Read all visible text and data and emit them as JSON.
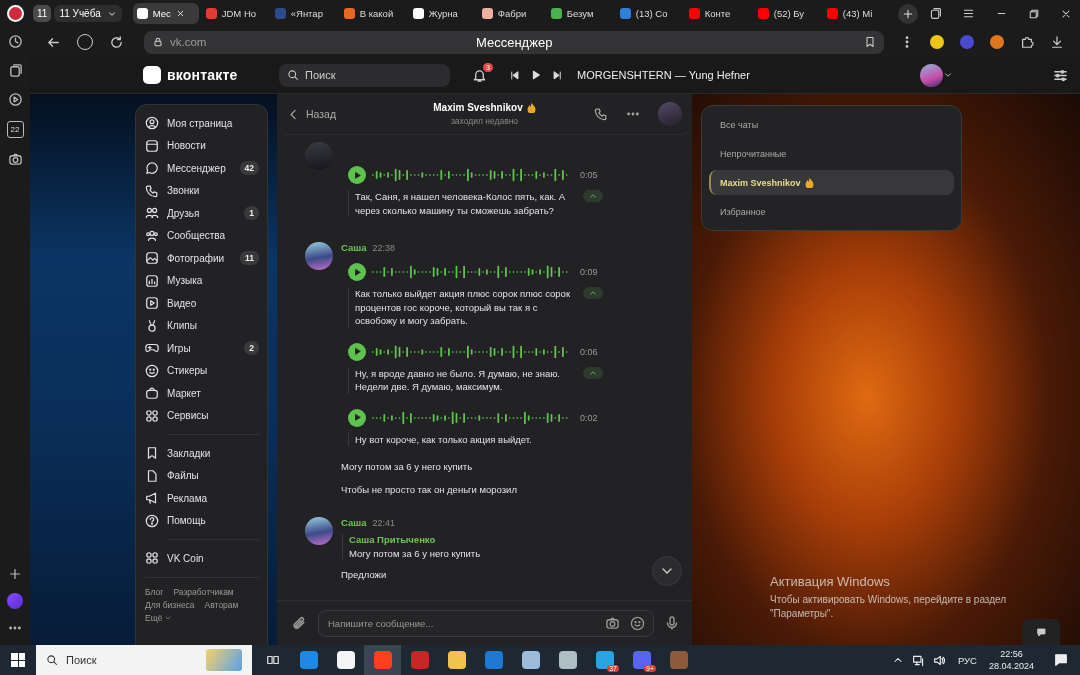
{
  "browser": {
    "tab_count": "11",
    "tab_group": "11 Учёба",
    "tabs": [
      {
        "label": "Мес",
        "selected": true,
        "color": "#ffffff"
      },
      {
        "label": "JDM Ho",
        "selected": false,
        "color": "#e03c31"
      },
      {
        "label": "«Янтар",
        "selected": false,
        "color": "#2d4a8a"
      },
      {
        "label": "В какой",
        "selected": false,
        "color": "#e8691e"
      },
      {
        "label": "Журна",
        "selected": false,
        "color": "#ffffff"
      },
      {
        "label": "Фабри",
        "selected": false,
        "color": "#f0b0a0"
      },
      {
        "label": "Безум",
        "selected": false,
        "color": "#4caf50"
      },
      {
        "label": "(13) Со",
        "selected": false,
        "color": "#2f7fd8"
      },
      {
        "label": "Конте",
        "selected": false,
        "color": "#ff0000"
      },
      {
        "label": "(52) Бу",
        "selected": false,
        "color": "#ff0000"
      },
      {
        "label": "(43) Мі",
        "selected": false,
        "color": "#ff0000"
      }
    ],
    "address": "vk.com",
    "page_title": "Мессенджер",
    "calendar_day": "22"
  },
  "vk_header": {
    "logo": "вконтакте",
    "search_placeholder": "Поиск",
    "notifications": "3",
    "track": "MORGENSHTERN — Yung Hefner"
  },
  "sidebar": {
    "sections": [
      [
        {
          "label": "Моя страница"
        },
        {
          "label": "Новости"
        },
        {
          "label": "Мессенджер",
          "count": "42"
        },
        {
          "label": "Звонки"
        },
        {
          "label": "Друзья",
          "count": "1"
        },
        {
          "label": "Сообщества"
        },
        {
          "label": "Фотографии",
          "count": "11"
        },
        {
          "label": "Музыка"
        },
        {
          "label": "Видео"
        },
        {
          "label": "Клипы"
        },
        {
          "label": "Игры",
          "count": "2"
        },
        {
          "label": "Стикеры"
        },
        {
          "label": "Маркет"
        },
        {
          "label": "Сервисы"
        }
      ],
      [
        {
          "label": "Закладки"
        },
        {
          "label": "Файлы"
        },
        {
          "label": "Реклама"
        },
        {
          "label": "Помощь"
        }
      ],
      [
        {
          "label": "VK Coin"
        }
      ]
    ],
    "footer_links": [
      "Блог",
      "Разработчикам",
      "Для бизнеса",
      "Авторам"
    ],
    "more": "Ещё"
  },
  "chat": {
    "back": "Назад",
    "name": "Maxim Sveshnikov",
    "status": "заходил недавно",
    "groups": [
      {
        "items": [
          {
            "kind": "voice",
            "duration": "0:05",
            "transcript": "Так, Саня, я нашел человека-Колос пять, как. А через сколько машину ты сможешь забрать?",
            "collapsible": true
          }
        ]
      },
      {
        "author": "Саша",
        "time": "22:38",
        "items": [
          {
            "kind": "voice",
            "duration": "0:09",
            "transcript": "Как только выйдет акция плюс сорок плюс сорок процентов гос короче, который вы так я с освобожу и могу забрать.",
            "collapsible": true
          },
          {
            "kind": "voice",
            "duration": "0:06",
            "transcript": "Ну, я вроде давно не было. Я думаю, не знаю. Недели две. Я думаю, максимум.",
            "collapsible": true
          },
          {
            "kind": "voice",
            "duration": "0:02",
            "transcript": "Ну вот короче, как только акция выйдет.",
            "collapsible": false
          },
          {
            "kind": "text",
            "text": "Могу потом за 6 у него купить"
          },
          {
            "kind": "text",
            "text": "Чтобы не просто так он деньги морозил"
          }
        ]
      },
      {
        "author": "Саша",
        "time": "22:41",
        "items": [
          {
            "kind": "reply",
            "author": "Саша Притыченко",
            "text": "Могу потом за 6 у него купить"
          },
          {
            "kind": "text",
            "text": "Предложи"
          }
        ]
      }
    ],
    "composer_placeholder": "Напишите сообщение..."
  },
  "folders": [
    {
      "label": "Все чаты",
      "selected": false
    },
    {
      "label": "Непрочитанные",
      "selected": false
    },
    {
      "label": "Maxim Sveshnikov",
      "selected": true
    },
    {
      "label": "Избранное",
      "selected": false
    }
  ],
  "system_notice": {
    "title": "Активация Windows",
    "text": "Чтобы активировать Windows, перейдите в раздел \"Параметры\"."
  },
  "taskbar": {
    "search_placeholder": "Поиск",
    "apps": [
      {
        "selected": false,
        "color": "#1e88e5"
      },
      {
        "selected": false,
        "color": "#f5f5f5"
      },
      {
        "selected": true,
        "color": "#fc3f1d"
      },
      {
        "selected": false,
        "color": "#c62828"
      },
      {
        "selected": false,
        "color": "#f2c14e"
      },
      {
        "selected": false,
        "color": "#1f78d1"
      },
      {
        "selected": false,
        "color": "#9bbbd9"
      },
      {
        "selected": false,
        "color": "#b0bec5"
      },
      {
        "selected": false,
        "color": "#2aa3e0",
        "badge": "37"
      },
      {
        "selected": false,
        "color": "#5865f2",
        "badge": "9+"
      },
      {
        "selected": false,
        "color": "#8d5b3a"
      }
    ],
    "language": "РУС",
    "time": "22:56",
    "date": "28.04.2024"
  }
}
